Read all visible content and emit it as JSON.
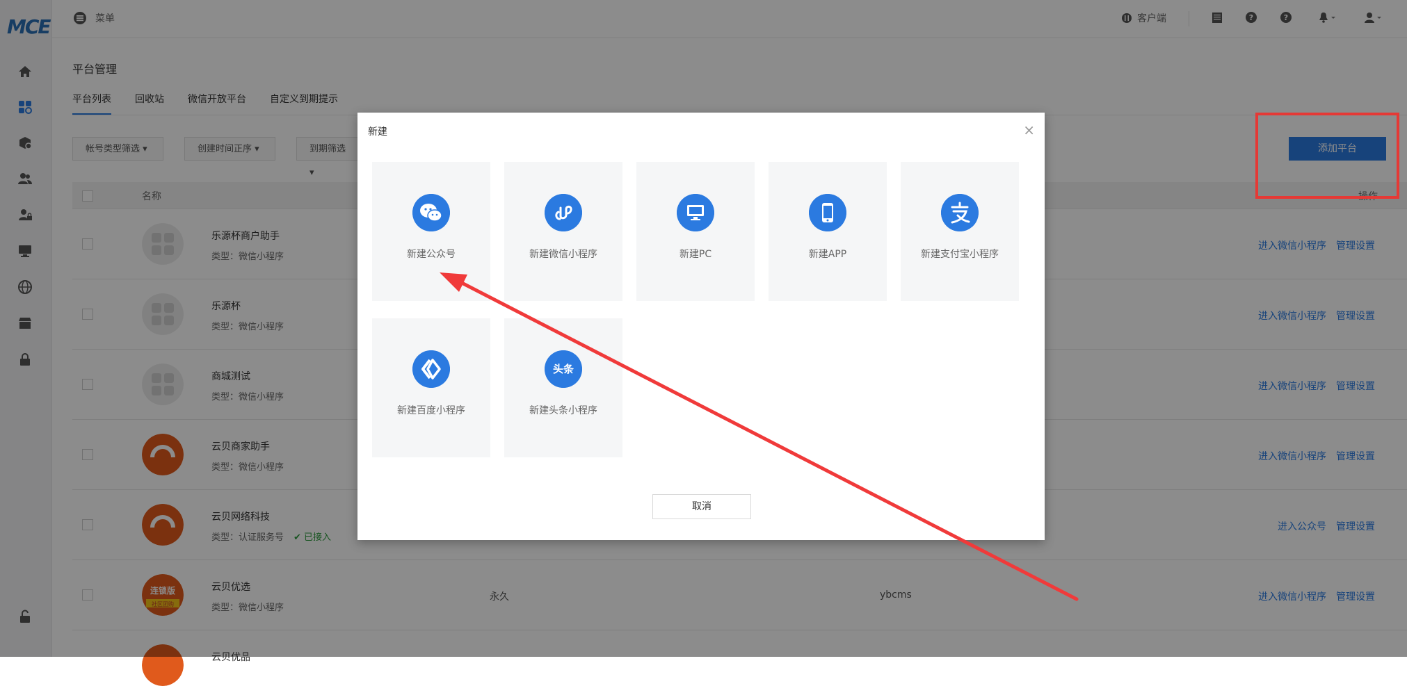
{
  "app": {
    "logo_text": "MCE",
    "menu_label": "菜单",
    "client_label": "客户端",
    "brand_color": "#2b7ae0"
  },
  "sidebar": {
    "items": [
      {
        "icon": "home-icon"
      },
      {
        "icon": "apps-icon"
      },
      {
        "icon": "package-icon"
      },
      {
        "icon": "users-icon"
      },
      {
        "icon": "user-lock-icon"
      },
      {
        "icon": "monitor-icon"
      },
      {
        "icon": "globe-icon"
      },
      {
        "icon": "store-icon"
      },
      {
        "icon": "lock-icon"
      },
      {
        "icon": "unlock-icon"
      }
    ]
  },
  "page": {
    "title": "平台管理",
    "tabs": [
      {
        "label": "平台列表"
      },
      {
        "label": "回收站"
      },
      {
        "label": "微信开放平台"
      },
      {
        "label": "自定义到期提示"
      }
    ],
    "filters": [
      {
        "label": "帐号类型筛选 ▾"
      },
      {
        "label": "创建时间正序 ▾"
      },
      {
        "label": "到期筛选 ▾"
      }
    ],
    "add_button": "添加平台",
    "table": {
      "header_name": "名称",
      "header_ops": "操作",
      "rows": [
        {
          "name": "乐源杯商户助手",
          "type": "类型：微信小程序",
          "status": "",
          "period": "",
          "account": "",
          "link1": "进入微信小程序",
          "link2": "管理设置"
        },
        {
          "name": "乐源杯",
          "type": "类型：微信小程序",
          "status": "",
          "period": "",
          "account": "",
          "link1": "进入微信小程序",
          "link2": "管理设置"
        },
        {
          "name": "商城测试",
          "type": "类型：微信小程序",
          "status": "",
          "period": "",
          "account": "",
          "link1": "进入微信小程序",
          "link2": "管理设置"
        },
        {
          "name": "云贝商家助手",
          "type": "类型：微信小程序",
          "status": "",
          "period": "",
          "account": "",
          "link1": "进入微信小程序",
          "link2": "管理设置"
        },
        {
          "name": "云贝网络科技",
          "type": "类型：认证服务号",
          "status": "已接入",
          "period": "",
          "account": "",
          "link1": "进入公众号",
          "link2": "管理设置"
        },
        {
          "name": "云贝优选",
          "type": "类型：微信小程序",
          "status": "",
          "period": "永久",
          "account": "ybcms",
          "link1": "进入微信小程序",
          "link2": "管理设置"
        },
        {
          "name": "云贝优品",
          "type": "",
          "status": "",
          "period": "",
          "account": "",
          "link1": "",
          "link2": ""
        }
      ]
    },
    "avatar_text": {
      "top": "连锁版",
      "bottom": "社区团购"
    }
  },
  "modal": {
    "title": "新建",
    "close": "×",
    "cards": [
      {
        "label": "新建公众号",
        "icon": "wechat-icon"
      },
      {
        "label": "新建微信小程序",
        "icon": "mini-program-icon"
      },
      {
        "label": "新建PC",
        "icon": "pc-monitor-icon"
      },
      {
        "label": "新建APP",
        "icon": "phone-icon"
      },
      {
        "label": "新建支付宝小程序",
        "icon": "alipay-icon"
      },
      {
        "label": "新建百度小程序",
        "icon": "baidu-icon"
      },
      {
        "label": "新建头条小程序",
        "icon": "toutiao-icon",
        "icon_text": "头条"
      }
    ],
    "cancel": "取消"
  }
}
